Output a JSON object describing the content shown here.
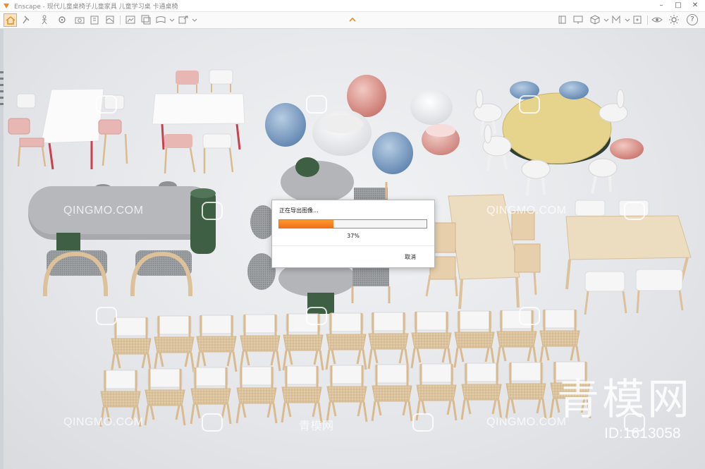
{
  "window": {
    "app_name": "Enscape",
    "title": "Enscape - 现代儿童桌椅子儿童家具 儿童学习桌 卡通桌椅"
  },
  "toolbar": {
    "left_icons": [
      "home-icon",
      "pin-icon",
      "walk-icon",
      "settings-icon",
      "camera-icon",
      "render-icon",
      "building-icon",
      "export-icon",
      "screenshot-icon",
      "panorama-icon",
      "video-icon",
      "batch-icon",
      "upload-icon"
    ],
    "right_icons": [
      "book-icon",
      "presentation-icon",
      "cube-icon",
      "material-icon",
      "asset-icon",
      "visibility-icon",
      "gear-icon",
      "help-icon"
    ],
    "help_label": "?"
  },
  "dialog": {
    "title": "正在导出图像...",
    "progress_text": "37%",
    "progress": 0.37,
    "cancel_label": "取消",
    "bar_color": "#f47d1f"
  },
  "watermarks": {
    "small": "QINGMO.COM",
    "small_cn": "青模网",
    "large": "青模网",
    "id": "ID:1613058"
  },
  "colors": {
    "accent": "#f3a548",
    "floor": "#e5e7ea",
    "wood": "#e2c9a4",
    "white": "#f7f7f7",
    "pink": "#e9b8b6",
    "blue": "#6f93bd",
    "sage": "#3d5e40",
    "gray_table": "#a9abae"
  }
}
